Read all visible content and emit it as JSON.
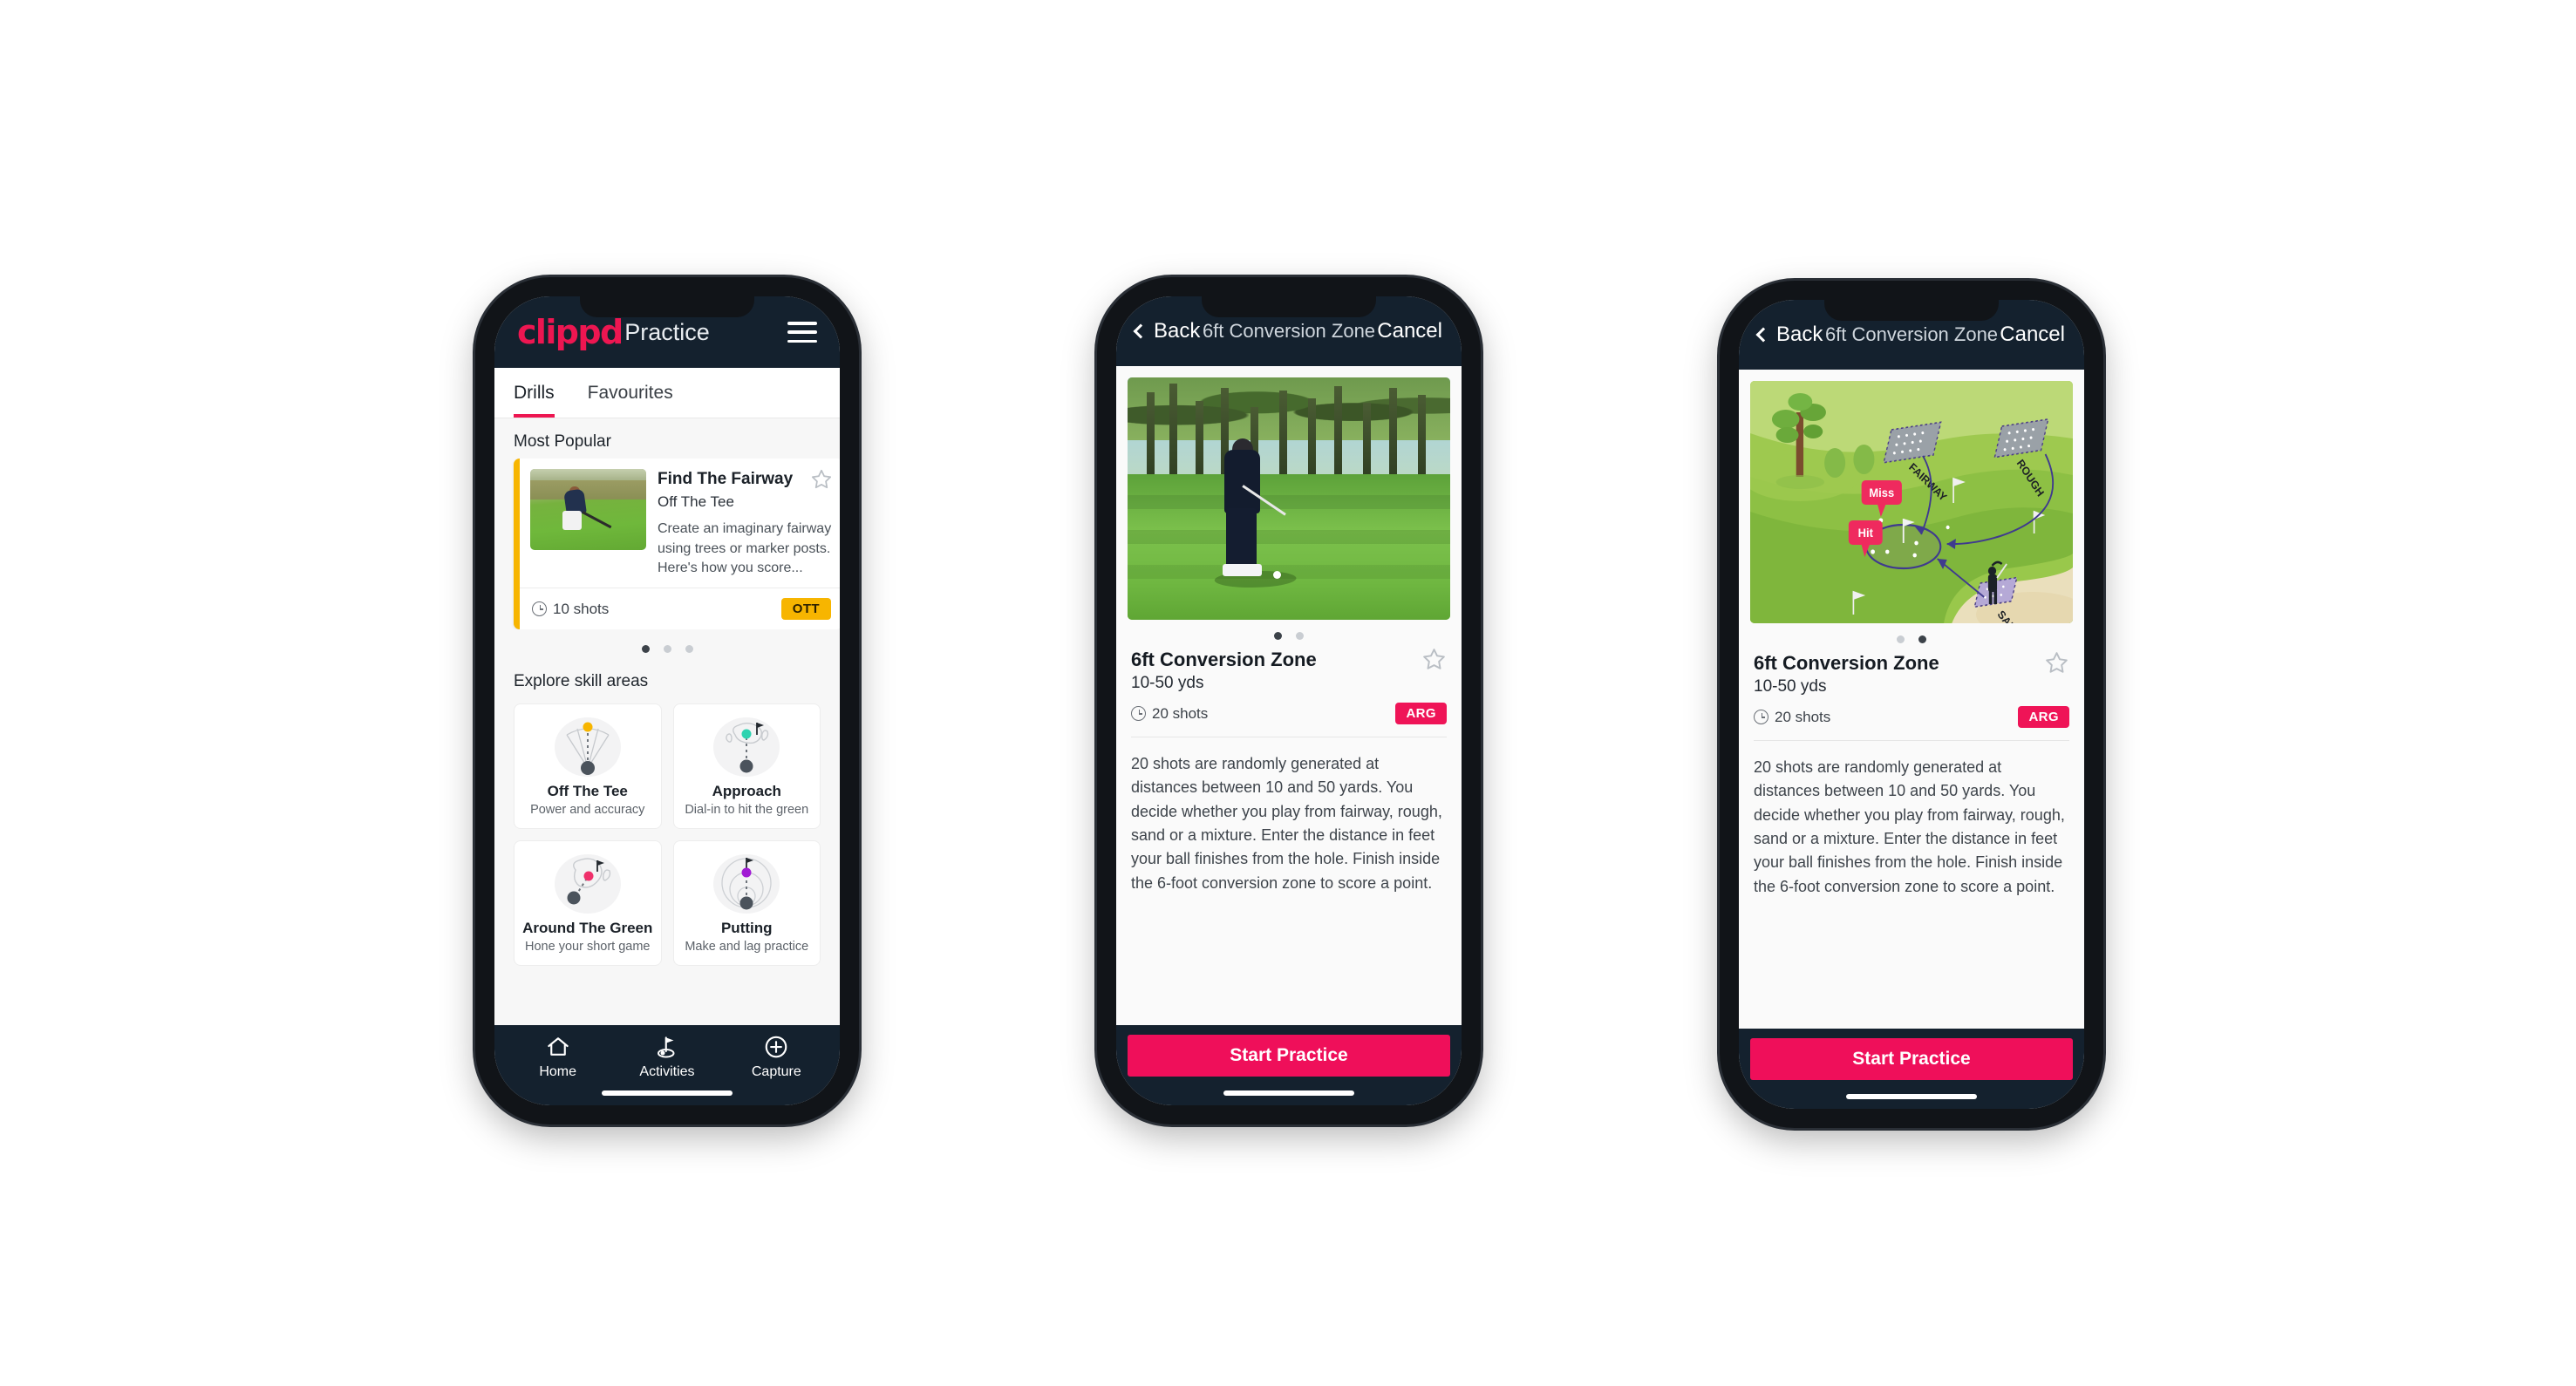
{
  "phone1": {
    "appbar": {
      "logo": "clippd",
      "title": "Practice",
      "menu_icon": "hamburger-menu-icon"
    },
    "tabs": [
      {
        "label": "Drills",
        "active": true
      },
      {
        "label": "Favourites",
        "active": false
      }
    ],
    "most_popular": {
      "section_title": "Most Popular",
      "card": {
        "title": "Find The Fairway",
        "subtitle": "Off The Tee",
        "description": "Create an imaginary fairway using trees or marker posts. Here's how you score...",
        "shots": "10 shots",
        "badge": "OTT",
        "badge_color": "#f7b500",
        "accent_color": "#f7b500",
        "next_card_accent": "#2ed3b0"
      },
      "dots": [
        true,
        false,
        false
      ]
    },
    "skill_areas": {
      "section_title": "Explore skill areas",
      "cards": [
        {
          "name": "Off The Tee",
          "desc": "Power and accuracy",
          "dot_color": "#f7b500",
          "icon": "tee-fan-icon"
        },
        {
          "name": "Approach",
          "desc": "Dial-in to hit the green",
          "dot_color": "#2ed3b0",
          "icon": "approach-green-icon"
        },
        {
          "name": "Around The Green",
          "desc": "Hone your short game",
          "dot_color": "#f0306b",
          "icon": "around-green-icon"
        },
        {
          "name": "Putting",
          "desc": "Make and lag practice",
          "dot_color": "#a11bd4",
          "icon": "putting-rings-icon"
        }
      ]
    },
    "tabbar": [
      {
        "label": "Home",
        "icon": "home-icon",
        "active": false
      },
      {
        "label": "Activities",
        "icon": "golf-flag-icon",
        "active": true
      },
      {
        "label": "Capture",
        "icon": "plus-circle-icon",
        "active": false
      }
    ]
  },
  "phone2": {
    "navbar": {
      "back": "Back",
      "title": "6ft Conversion Zone",
      "cancel": "Cancel"
    },
    "hero": "golfer-chipping-photo",
    "dots": [
      true,
      false
    ],
    "detail": {
      "title": "6ft Conversion Zone",
      "subtitle": "10-50 yds",
      "shots": "20 shots",
      "badge": "ARG",
      "badge_color": "#ef1457",
      "description": "20 shots are randomly generated at distances between 10 and 50 yards. You decide whether you play from fairway, rough, sand or a mixture. Enter the distance in feet your ball finishes from the hole. Finish inside the 6-foot conversion zone to score a point."
    },
    "cta": {
      "label": "Start Practice",
      "color": "#ef0f5a"
    }
  },
  "phone3": {
    "navbar": {
      "back": "Back",
      "title": "6ft Conversion Zone",
      "cancel": "Cancel"
    },
    "hero": "golf-course-illustration",
    "illustration": {
      "labels": [
        "FAIRWAY",
        "ROUGH",
        "SAND"
      ],
      "markers": [
        {
          "text": "Miss",
          "color": "#ef2a5e"
        },
        {
          "text": "Hit",
          "color": "#ef2a5e"
        }
      ]
    },
    "dots": [
      false,
      true
    ],
    "detail": {
      "title": "6ft Conversion Zone",
      "subtitle": "10-50 yds",
      "shots": "20 shots",
      "badge": "ARG",
      "badge_color": "#ef1457",
      "description": "20 shots are randomly generated at distances between 10 and 50 yards. You decide whether you play from fairway, rough, sand or a mixture. Enter the distance in feet your ball finishes from the hole. Finish inside the 6-foot conversion zone to score a point."
    },
    "cta": {
      "label": "Start Practice",
      "color": "#ef0f5a"
    }
  }
}
